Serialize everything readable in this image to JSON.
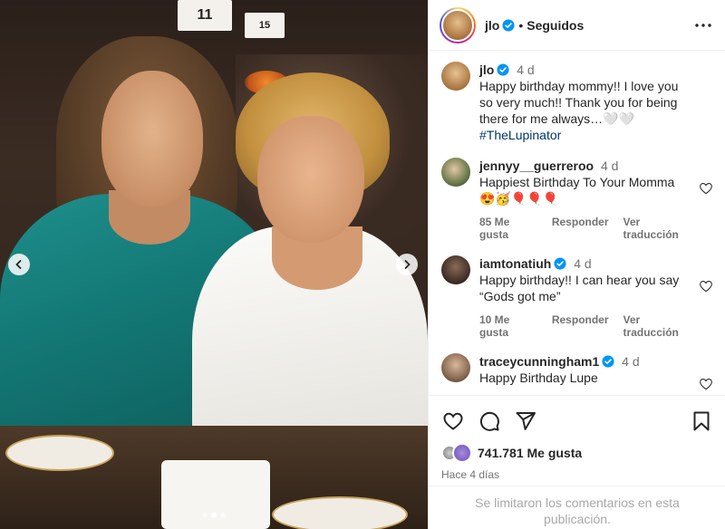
{
  "post": {
    "username": "jlo",
    "separator": "•",
    "follow_status": "Seguidos",
    "image_alt_visible": false,
    "carousel": {
      "slides": 3,
      "active": 1
    }
  },
  "photo_labels": {
    "table_number_1": "11",
    "table_number_2": "15"
  },
  "caption": {
    "user": "jlo",
    "time": "4 d",
    "text": "Happy birthday mommy!! I love you so very much!! Thank you for being there for me always…🤍🤍",
    "hashtag": "#TheLupinator"
  },
  "comments": [
    {
      "user": "jennyy__guerreroo",
      "time": "4 d",
      "text": "Happiest Birthday To Your Momma 😍🥳🎈🎈🎈",
      "likes": "85 Me gusta",
      "reply": "Responder",
      "translate": "Ver traducción"
    },
    {
      "user": "iamtonatiuh",
      "time": "4 d",
      "text": "Happy birthday!! I can hear you say “Gods got me”",
      "likes": "10 Me gusta",
      "reply": "Responder",
      "translate": "Ver traducción"
    },
    {
      "user": "traceycunningham1",
      "time": "4 d",
      "text": "Happy Birthday Lupe"
    }
  ],
  "likes_summary": {
    "count": "741.781 Me gusta",
    "time_ago": "Hace 4 días"
  },
  "comments_closed": "Se limitaron los comentarios en esta publicación.",
  "icons": {
    "more": "more-horizontal-icon",
    "verified": "verified-badge-icon",
    "like": "heart-icon",
    "comment": "comment-icon",
    "share": "share-icon",
    "save": "bookmark-icon",
    "prev": "chevron-left-icon",
    "next": "chevron-right-icon"
  },
  "colors": {
    "verified": "#0095f6",
    "hashtag": "#00376b",
    "muted": "#737373",
    "text": "#262626"
  }
}
